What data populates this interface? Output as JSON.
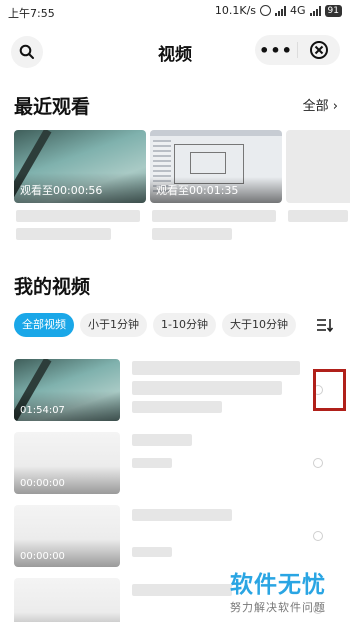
{
  "status_bar": {
    "time": "上午7:55",
    "speed": "10.1K/s",
    "network": "4G",
    "battery": "91"
  },
  "header": {
    "title": "视频",
    "more_label": "•••"
  },
  "recent": {
    "title": "最近观看",
    "all_label": "全部",
    "items": [
      {
        "progress": "观看至00:00:56"
      },
      {
        "progress": "观看至00:01:35"
      },
      {
        "progress": ""
      }
    ]
  },
  "my_videos": {
    "title": "我的视频",
    "filters": [
      {
        "label": "全部视频",
        "active": true
      },
      {
        "label": "小于1分钟",
        "active": false
      },
      {
        "label": "1-10分钟",
        "active": false
      },
      {
        "label": "大于10分钟",
        "active": false
      }
    ],
    "videos": [
      {
        "duration": "01:54:07",
        "selected": false
      },
      {
        "duration": "00:00:00",
        "selected": false
      },
      {
        "duration": "00:00:00",
        "selected": false
      },
      {
        "duration": "",
        "selected": false
      }
    ]
  },
  "watermark": {
    "line1": "软件无忧",
    "line2": "努力解决软件问题"
  },
  "colors": {
    "accent": "#1aa7e8",
    "highlight": "#b0201a",
    "watermark": "#2aa5e3"
  }
}
